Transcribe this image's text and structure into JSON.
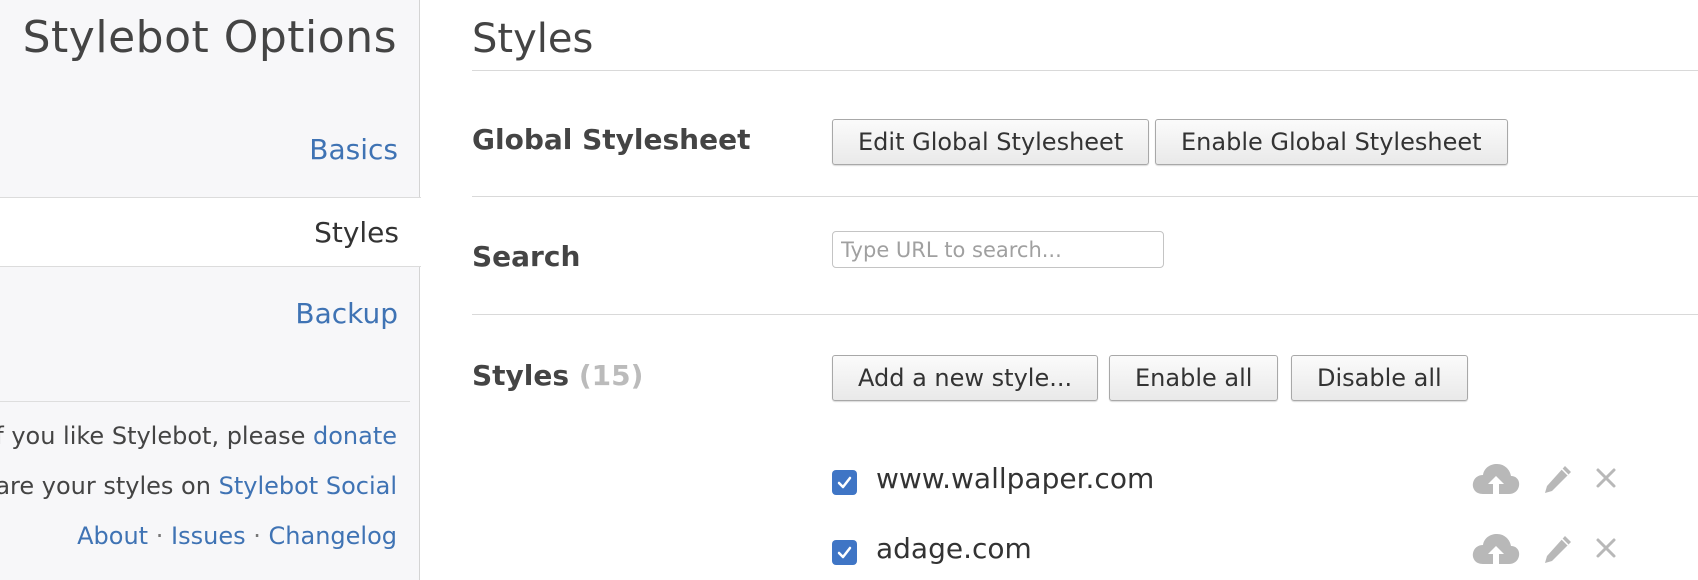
{
  "sidebar": {
    "title": "Stylebot Options",
    "nav": [
      {
        "label": "Basics",
        "active": false
      },
      {
        "label": "Styles",
        "active": true
      },
      {
        "label": "Backup",
        "active": false
      }
    ],
    "footer": {
      "donate_prefix": "If you like Stylebot, please",
      "donate_link": "donate",
      "share_prefix": "Share your styles on",
      "share_link": "Stylebot Social",
      "links": [
        "About",
        "Issues",
        "Changelog"
      ],
      "separator": "·"
    }
  },
  "main": {
    "title": "Styles",
    "global": {
      "label": "Global Stylesheet",
      "edit_button": "Edit Global Stylesheet",
      "enable_button": "Enable Global Stylesheet"
    },
    "search": {
      "label": "Search",
      "placeholder": "Type URL to search...",
      "value": ""
    },
    "styles": {
      "label": "Styles",
      "count": "(15)",
      "add_button": "Add a new style...",
      "enable_all_button": "Enable all",
      "disable_all_button": "Disable all",
      "items": [
        {
          "url": "www.wallpaper.com",
          "enabled": true,
          "icons": [
            "cloud-upload-icon",
            "pencil-icon",
            "close-icon"
          ]
        },
        {
          "url": "adage.com",
          "enabled": true,
          "icons": [
            "cloud-upload-icon",
            "pencil-icon",
            "close-icon"
          ]
        }
      ]
    }
  },
  "colors": {
    "link": "#3f73b4",
    "checkbox": "#3f75c5",
    "sidebar_bg": "#f7f7f9",
    "icon_gray": "#b8b8b8",
    "count_gray": "#bbbbbb"
  }
}
